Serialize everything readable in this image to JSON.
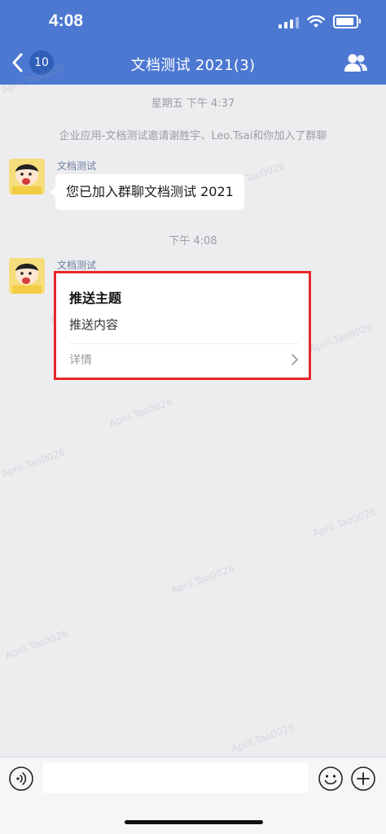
{
  "status_bar": {
    "time": "4:08"
  },
  "nav": {
    "unread_badge": "10",
    "title": "文档测试 2021(3)"
  },
  "chat": {
    "time_separator_1": "星期五 下午 4:37",
    "system_message": "企业应用-文档测试邀请谢胜宇、Leo.Tsai和你加入了群聊",
    "message_1": {
      "sender": "文档测试",
      "text": "您已加入群聊文档测试 2021"
    },
    "time_separator_2": "下午 4:08",
    "message_2": {
      "sender": "文档测试",
      "card_title": "推送主题",
      "card_body": "推送内容",
      "card_detail": "详情"
    }
  },
  "watermark": "April.Tao0026",
  "icons": {
    "back": "chevron-left-icon",
    "members": "group-members-icon",
    "voice": "voice-icon",
    "emoji": "emoji-icon",
    "plus": "plus-icon"
  },
  "colors": {
    "header": "#4c78d1",
    "highlight_border": "#e8262b",
    "background": "#ededf0"
  }
}
